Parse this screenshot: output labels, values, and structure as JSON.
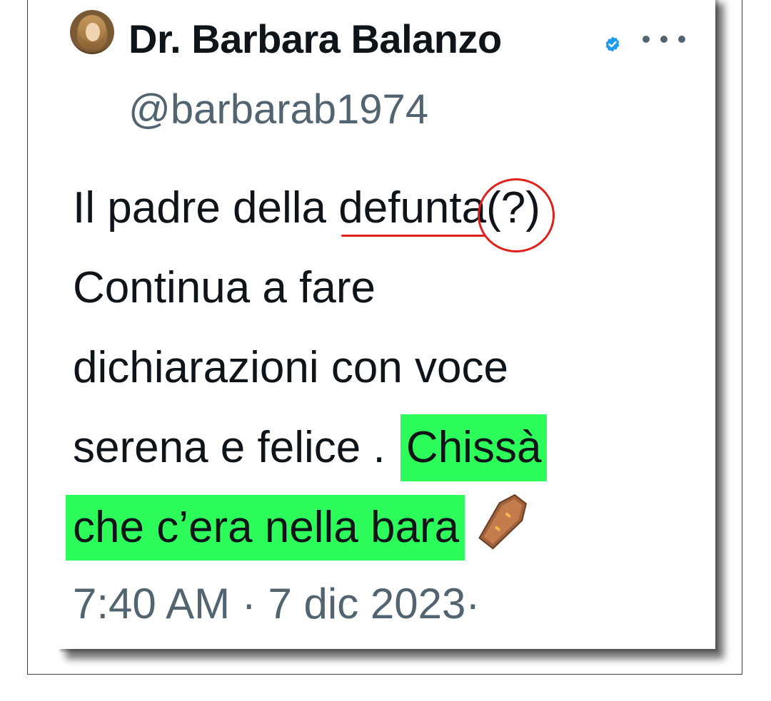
{
  "tweet": {
    "author": {
      "display_name": "Dr. Barbara Balanzo",
      "handle": "@barbarab1974",
      "verified": true,
      "avatar_icon": "avatar-photo"
    },
    "more_icon": "more-options-icon",
    "text": {
      "line1_prefix": "Il padre della ",
      "line1_underlined": "defunta",
      "line1_circled": "(?)",
      "line2": "Continua a fare",
      "line3": "dichiarazioni con voce",
      "line4_plain": "serena  e felice . ",
      "line4_highlighted": "Chissà",
      "line5_highlighted": "che c’era nella bara",
      "emoji_icon": "coffin-icon"
    },
    "timestamp": "7:40 AM · 7 dic 2023·"
  },
  "colors": {
    "text": "#0f1419",
    "secondary": "#536471",
    "verified_blue": "#1d9bf0",
    "annotation_red": "#e0201b",
    "highlight_green": "#2dfd5a"
  }
}
